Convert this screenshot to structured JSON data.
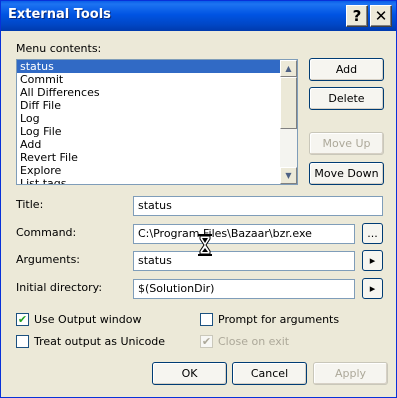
{
  "dialog": {
    "title": "External Tools",
    "help_glyph": "?",
    "close_glyph": "✕"
  },
  "menu_contents": {
    "label": "Menu contents:",
    "items": [
      "status",
      "Commit",
      "All Differences",
      "Diff File",
      "Log",
      "Log File",
      "Add",
      "Revert File",
      "Explore",
      "List tags"
    ],
    "selected_index": 0
  },
  "side_buttons": {
    "add": "Add",
    "delete": "Delete",
    "move_up": "Move Up",
    "move_down": "Move Down"
  },
  "fields": {
    "title": {
      "label": "Title:",
      "value": "status"
    },
    "command": {
      "label": "Command:",
      "value": "C:\\Program Files\\Bazaar\\bzr.exe",
      "browse": "..."
    },
    "arguments": {
      "label": "Arguments:",
      "value": "status",
      "arrow": "▸"
    },
    "initial_directory": {
      "label": "Initial directory:",
      "value": "$(SolutionDir)",
      "arrow": "▸"
    }
  },
  "options": {
    "use_output_window": {
      "label": "Use Output window",
      "checked": true
    },
    "treat_output_unicode": {
      "label": "Treat output as Unicode",
      "checked": false
    },
    "prompt_for_arguments": {
      "label": "Prompt for arguments",
      "checked": false
    },
    "close_on_exit": {
      "label": "Close on exit",
      "checked": true,
      "disabled": true
    }
  },
  "footer": {
    "ok": "OK",
    "cancel": "Cancel",
    "apply": "Apply"
  },
  "checkmark": "✔"
}
